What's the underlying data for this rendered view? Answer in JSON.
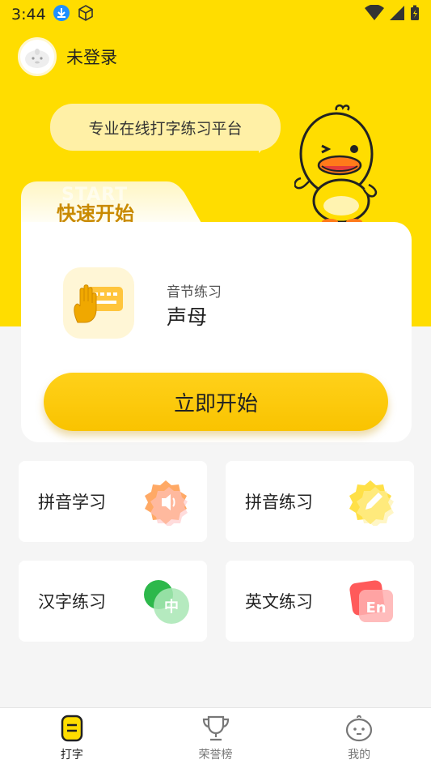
{
  "status_bar": {
    "time": "3:44"
  },
  "profile": {
    "login_text": "未登录"
  },
  "slogan": "专业在线打字练习平台",
  "quick_start": {
    "watermark": "START",
    "title": "快速开始",
    "practice_subtitle": "音节练习",
    "practice_title": "声母",
    "start_button": "立即开始"
  },
  "features": [
    {
      "label": "拼音学习",
      "icon": "speaker-icon"
    },
    {
      "label": "拼音练习",
      "icon": "pencil-icon"
    },
    {
      "label": "汉字练习",
      "icon": "chinese-char-icon"
    },
    {
      "label": "英文练习",
      "icon": "english-en-icon"
    }
  ],
  "bottom_nav": [
    {
      "label": "打字",
      "icon": "typing-icon",
      "active": true
    },
    {
      "label": "荣誉榜",
      "icon": "trophy-icon",
      "active": false
    },
    {
      "label": "我的",
      "icon": "profile-icon",
      "active": false
    }
  ],
  "colors": {
    "accent": "#ffdd00",
    "button": "#f9c300",
    "title": "#c98a00"
  }
}
